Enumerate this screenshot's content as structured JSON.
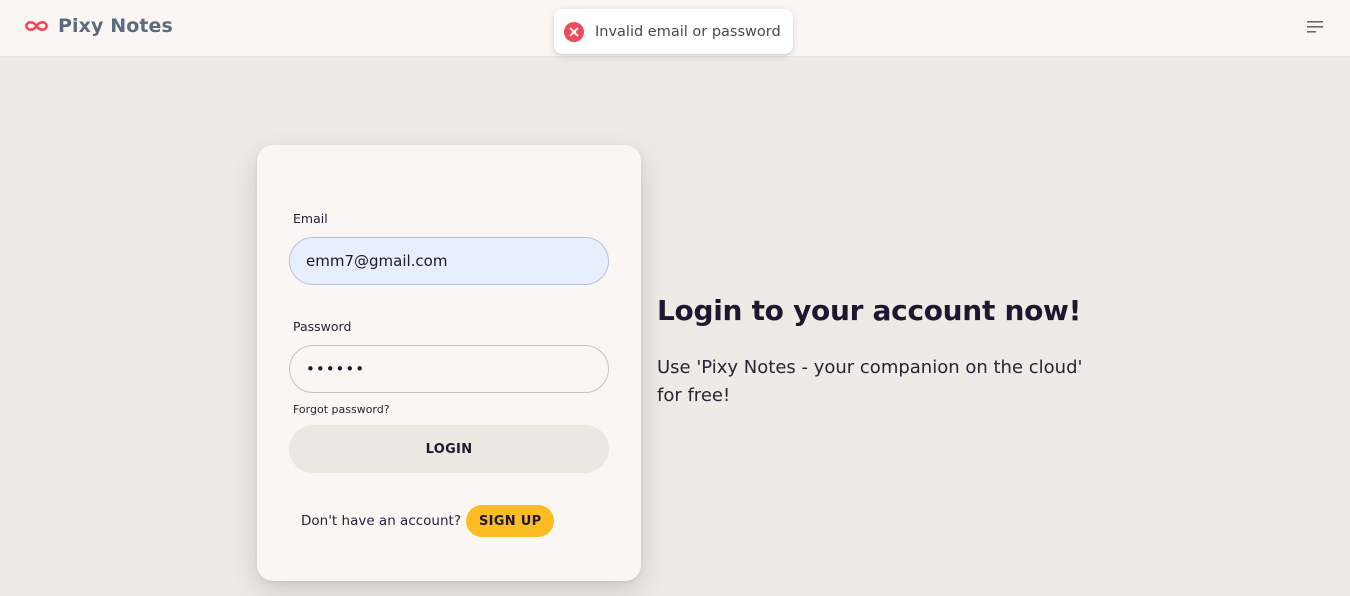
{
  "navbar": {
    "brand_name": "Pixy Notes",
    "logo_icon": "infinity-icon",
    "menu_icon": "menu-icon"
  },
  "toast": {
    "icon": "error-icon",
    "message": "Invalid email or password"
  },
  "login_form": {
    "email_label": "Email",
    "email_value": "emm7@gmail.com",
    "password_label": "Password",
    "password_value": "••••••",
    "forgot_password": "Forgot password?",
    "login_button": "LOGIN",
    "signup_prompt": "Don't have an account?",
    "signup_button": "SIGN UP"
  },
  "hero": {
    "title": "Login to your account now!",
    "text": "Use 'Pixy Notes - your companion on the cloud' for free!"
  },
  "colors": {
    "brand_accent": "#f3455c",
    "page_background": "#efeae5",
    "card_background": "#faf6f3",
    "signup_button": "#fbbd23",
    "error": "#f04a5a"
  }
}
